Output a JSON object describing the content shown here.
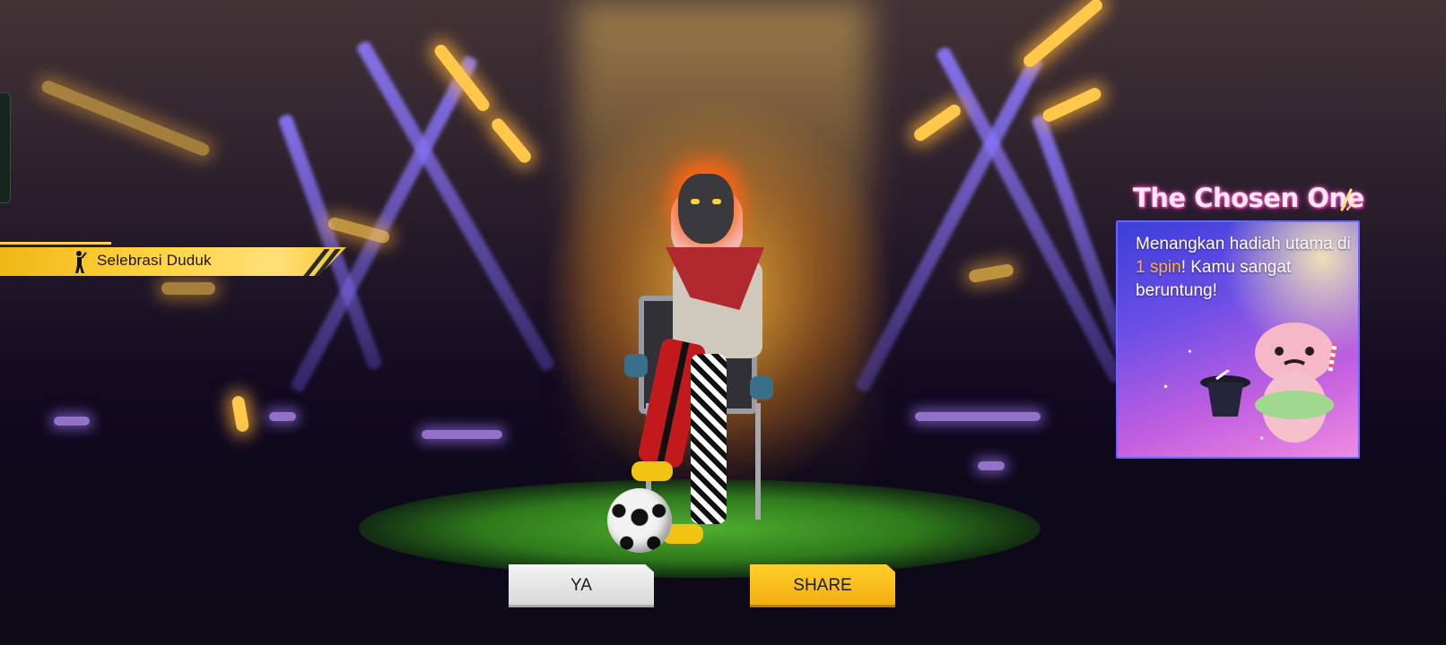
{
  "emote_banner": {
    "label": "Selebrasi Duduk",
    "icon": "sitting-figure-icon"
  },
  "reward": {
    "title": "The Chosen One",
    "message_part1": "Menangkan hadiah utama di ",
    "highlight": "1 spin",
    "message_part2": "! Kamu sangat beruntung!",
    "highlight_color": "#ffb347"
  },
  "buttons": {
    "ya_label": "YA",
    "share_label": "SHARE"
  },
  "colors": {
    "banner_yellow": "#ffd440",
    "share_yellow": "#f7b81a",
    "card_purple": "#6b4ee6"
  }
}
